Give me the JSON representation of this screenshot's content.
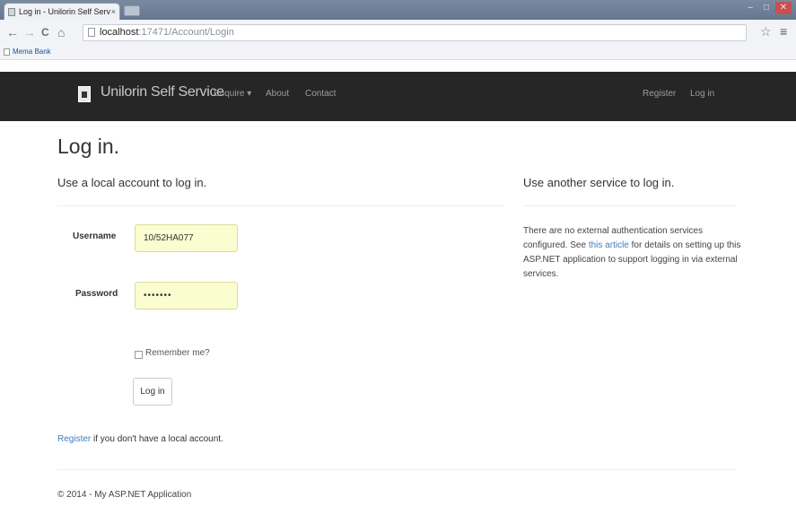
{
  "browser": {
    "tab_title": "Log in - Unilorin Self Serv",
    "tab_close": "×",
    "url_host": "localhost",
    "url_path": ":17471/Account/Login",
    "bookmark": "Mema Bank",
    "nav_back": "←",
    "nav_forward": "→",
    "nav_reload": "C",
    "nav_home": "⌂",
    "star": "☆",
    "menu": "≡",
    "win_min": "–",
    "win_max": "□",
    "win_close": "✕"
  },
  "navbar": {
    "brand": "Unilorin Self Service",
    "links": [
      "Enquire ▾",
      "About",
      "Contact"
    ],
    "right_links": [
      "Register",
      "Log in"
    ]
  },
  "main": {
    "title": "Log in.",
    "local_heading": "Use a local account to log in.",
    "username_label": "Username",
    "username_value": "10/52HA077",
    "password_label": "Password",
    "password_value": "•••••••",
    "remember_label": "Remember me?",
    "login_button": "Log in",
    "register_link": "Register",
    "register_suffix": " if you don't have a local account."
  },
  "external": {
    "heading": "Use another service to log in.",
    "line1": "There are no external authentication services configured.",
    "see": "See ",
    "link": "this article",
    "rest": " for details on setting up this ASP.NET application to support logging in via external services."
  },
  "footer": {
    "text": "© 2014 - My ASP.NET Application"
  }
}
